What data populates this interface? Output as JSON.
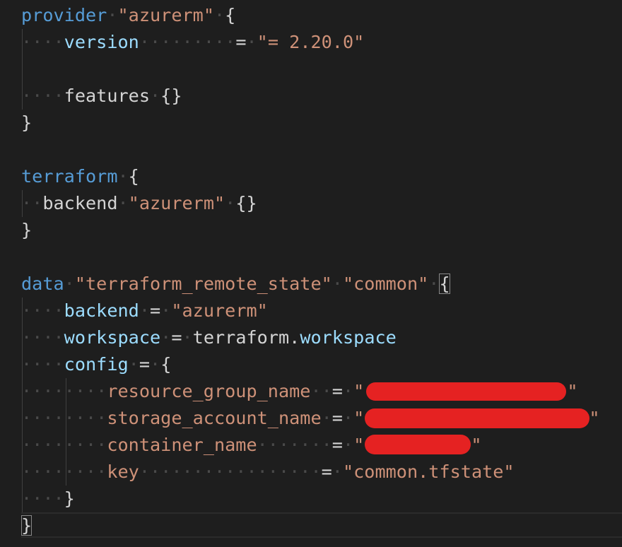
{
  "editor": {
    "theme_colors": {
      "background": "#1e1e1e",
      "keyword": "#569cd6",
      "property": "#9cdcfe",
      "string": "#ce9178",
      "text": "#d4d4d4",
      "redaction": "#e52222"
    },
    "provider_block": {
      "keyword": "provider",
      "name": "\"azurerm\"",
      "open_brace": "{",
      "version_attr": "version",
      "version_eq": "=",
      "version_value": "\"= 2.20.0\"",
      "features_attr": "features",
      "features_value": "{}",
      "close_brace": "}"
    },
    "terraform_block": {
      "keyword": "terraform",
      "open_brace": "{",
      "backend_keyword": "backend",
      "backend_name": "\"azurerm\"",
      "backend_body": "{}",
      "close_brace": "}"
    },
    "data_block": {
      "keyword": "data",
      "type": "\"terraform_remote_state\"",
      "name": "\"common\"",
      "open_brace": "{",
      "backend_attr": "backend",
      "backend_eq": "=",
      "backend_value": "\"azurerm\"",
      "workspace_attr": "workspace",
      "workspace_eq": "=",
      "workspace_ref_object": "terraform.",
      "workspace_ref_property": "workspace",
      "config_attr": "config",
      "config_eq": "=",
      "config_open": "{",
      "config": {
        "resource_group_name": {
          "key": "resource_group_name",
          "eq": "=",
          "quote_open": "\"",
          "quote_close": "\""
        },
        "storage_account_name": {
          "key": "storage_account_name",
          "eq": "=",
          "quote_open": "\"",
          "quote_close": "\""
        },
        "container_name": {
          "key": "container_name",
          "eq": "=",
          "quote_open": "\"",
          "quote_close": "\""
        },
        "key": {
          "key": "key",
          "eq": "=",
          "value": "\"common.tfstate\""
        }
      },
      "config_close": "}",
      "close_brace": "}"
    }
  }
}
